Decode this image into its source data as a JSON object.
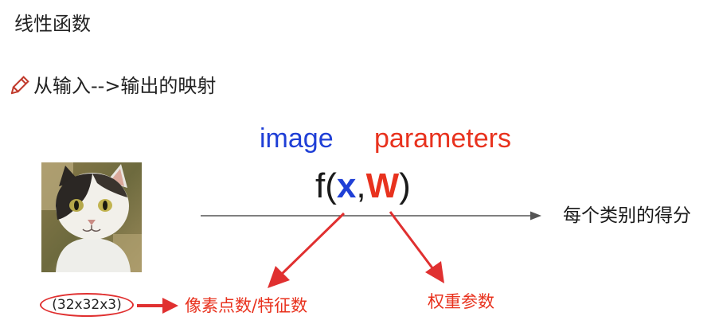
{
  "title": "线性函数",
  "subtitle": "从输入-->输出的映射",
  "labels": {
    "image": "image",
    "parameters": "parameters"
  },
  "formula": {
    "open": "f(",
    "x": "x",
    "comma": ",",
    "w": "W",
    "close": ")"
  },
  "output_label": "每个类别的得分",
  "input_dims": "(32x32x3)",
  "pixel_label": "像素点数/特征数",
  "weight_label": "权重参数",
  "icons": {
    "pencil": "pencil-icon",
    "photo": "cat-photo"
  },
  "colors": {
    "blue": "#1f3fd6",
    "red": "#e8321e",
    "arrow_red": "#e03030",
    "text": "#222222"
  }
}
